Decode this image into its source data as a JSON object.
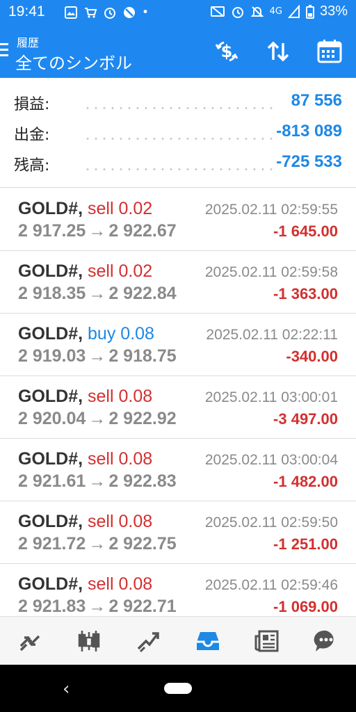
{
  "status_bar": {
    "time": "19:41",
    "network": "4G",
    "battery": "33%"
  },
  "header": {
    "subtitle": "履歴",
    "title": "全てのシンボル",
    "actions": [
      "dollar-exchange-icon",
      "sort-icon",
      "calendar-icon"
    ]
  },
  "summary": {
    "profit_label": "損益:",
    "profit_value": "87 556",
    "withdrawal_label": "出金:",
    "withdrawal_value": "-813 089",
    "balance_label": "残高:",
    "balance_value": "-725 533"
  },
  "trades": [
    {
      "symbol": "GOLD#,",
      "side": "sell 0.02",
      "type": "sell",
      "open": "2 917.25",
      "arrow": "→",
      "close": "2 922.67",
      "date": "2025.02.11 02:59:55",
      "profit": "-1 645.00"
    },
    {
      "symbol": "GOLD#,",
      "side": "sell 0.02",
      "type": "sell",
      "open": "2 918.35",
      "arrow": "→",
      "close": "2 922.84",
      "date": "2025.02.11 02:59:58",
      "profit": "-1 363.00"
    },
    {
      "symbol": "GOLD#,",
      "side": "buy 0.08",
      "type": "buy",
      "open": "2 919.03",
      "arrow": "→",
      "close": "2 918.75",
      "date": "2025.02.11 02:22:11",
      "profit": "-340.00"
    },
    {
      "symbol": "GOLD#,",
      "side": "sell 0.08",
      "type": "sell",
      "open": "2 920.04",
      "arrow": "→",
      "close": "2 922.92",
      "date": "2025.02.11 03:00:01",
      "profit": "-3 497.00"
    },
    {
      "symbol": "GOLD#,",
      "side": "sell 0.08",
      "type": "sell",
      "open": "2 921.61",
      "arrow": "→",
      "close": "2 922.83",
      "date": "2025.02.11 03:00:04",
      "profit": "-1 482.00"
    },
    {
      "symbol": "GOLD#,",
      "side": "sell 0.08",
      "type": "sell",
      "open": "2 921.72",
      "arrow": "→",
      "close": "2 922.75",
      "date": "2025.02.11 02:59:50",
      "profit": "-1 251.00"
    },
    {
      "symbol": "GOLD#,",
      "side": "sell 0.08",
      "type": "sell",
      "open": "2 921.83",
      "arrow": "→",
      "close": "2 922.71",
      "date": "2025.02.11 02:59:46",
      "profit": "-1 069.00"
    }
  ],
  "bottom_nav": [
    "quotes-icon",
    "chart-icon",
    "trade-icon",
    "history-icon",
    "news-icon",
    "chat-icon"
  ],
  "active_tab": "history-icon",
  "colors": {
    "accent": "#1e88f0",
    "sell": "#d32f2f",
    "buy": "#1e88e5",
    "value_blue": "#1e88e5"
  }
}
